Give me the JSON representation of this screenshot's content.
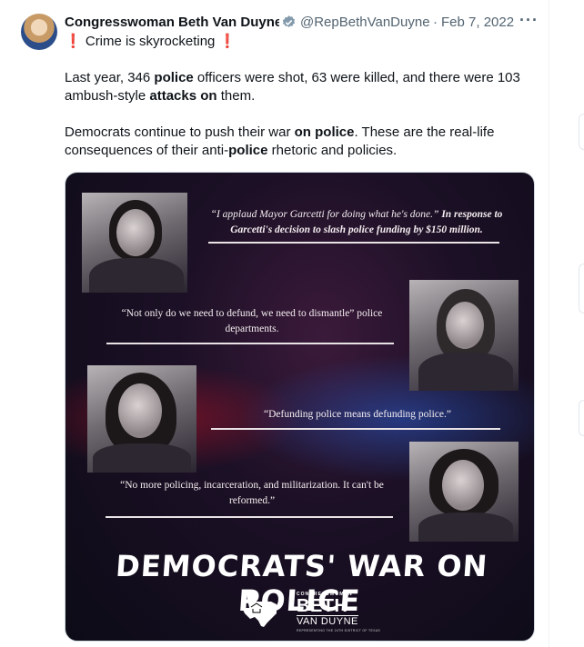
{
  "author": {
    "name": "Congresswoman Beth Van Duyne",
    "handle": "@RepBethVanDuyne",
    "date": "Feb 7, 2022",
    "more": "···"
  },
  "tweet": {
    "line1_prefix": "❗",
    "line1_text": " Crime is skyrocketing ",
    "line1_suffix": "❗",
    "p1_a": "Last year, 346 ",
    "p1_b": "police",
    "p1_c": " officers were shot, 63 were killed, and there were 103 ambush-style ",
    "p1_d": "attacks on",
    "p1_e": " them.",
    "p2_a": "Democrats continue to push their war ",
    "p2_b": "on police",
    "p2_c": ". These are the real-life consequences of their anti-",
    "p2_d": "police",
    "p2_e": " rhetoric and policies."
  },
  "media": {
    "quote1_a": "“I applaud Mayor Garcetti for doing what he's done.”",
    "quote1_b": " In response to Garcetti's decision to slash police funding by $150 million.",
    "quote2": "“Not only do we need to defund, we need to dismantle” police departments.",
    "quote3": "“Defunding police means defunding police.”",
    "quote4": "“No more policing, incarceration, and militarization. It can't be reformed.”",
    "banner": "DEMOCRATS' WAR ON POLICE",
    "logo_small": "CONGRESSWOMAN",
    "logo_big": "BETH",
    "logo_van": "VAN DUYNE",
    "logo_tag": "REPRESENTING THE 24TH DISTRICT OF TEXAS"
  },
  "colors": {
    "verified_badge": "#829aab",
    "accent_text": "#0f1419",
    "muted": "#536471"
  }
}
